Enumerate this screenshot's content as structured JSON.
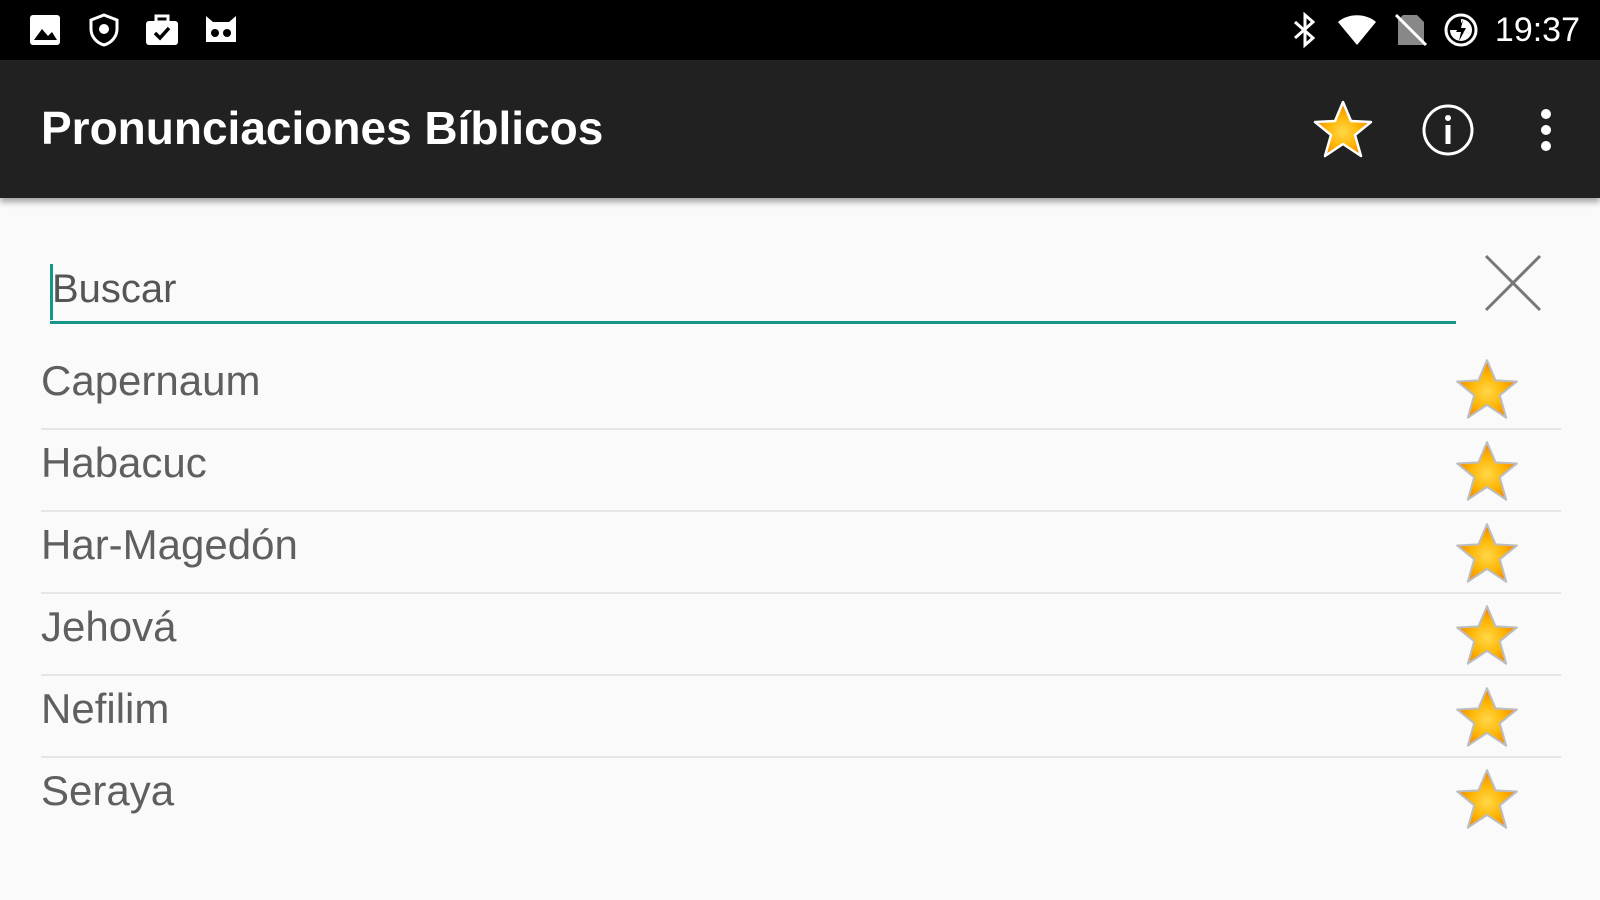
{
  "status_bar": {
    "icons_left": [
      "image-icon",
      "shield-icon",
      "briefcase-check-icon",
      "cat-face-icon"
    ],
    "icons_right": [
      "bluetooth-icon",
      "wifi-icon",
      "no-sim-icon",
      "battery-charging-icon"
    ],
    "time": "19:37"
  },
  "app_bar": {
    "title": "Pronunciaciones Bíblicos",
    "actions": [
      "star-icon",
      "info-icon",
      "overflow-menu-icon"
    ]
  },
  "search": {
    "placeholder": "Buscar",
    "value": "",
    "accent_color": "#16958a",
    "clear_icon": "close-icon"
  },
  "list": {
    "items": [
      {
        "label": "Capernaum",
        "icon": "star-icon"
      },
      {
        "label": "Habacuc",
        "icon": "star-icon"
      },
      {
        "label": "Har-Magedón",
        "icon": "star-icon"
      },
      {
        "label": "Jehová",
        "icon": "star-icon"
      },
      {
        "label": "Nefilim",
        "icon": "star-icon"
      },
      {
        "label": "Seraya",
        "icon": "star-icon"
      }
    ]
  },
  "colors": {
    "status_bar": "#000000",
    "app_bar": "#212121",
    "background": "#fafafa",
    "accent": "#16958a",
    "star_fill": "#ffa000",
    "item_text": "#5f5f5f"
  }
}
